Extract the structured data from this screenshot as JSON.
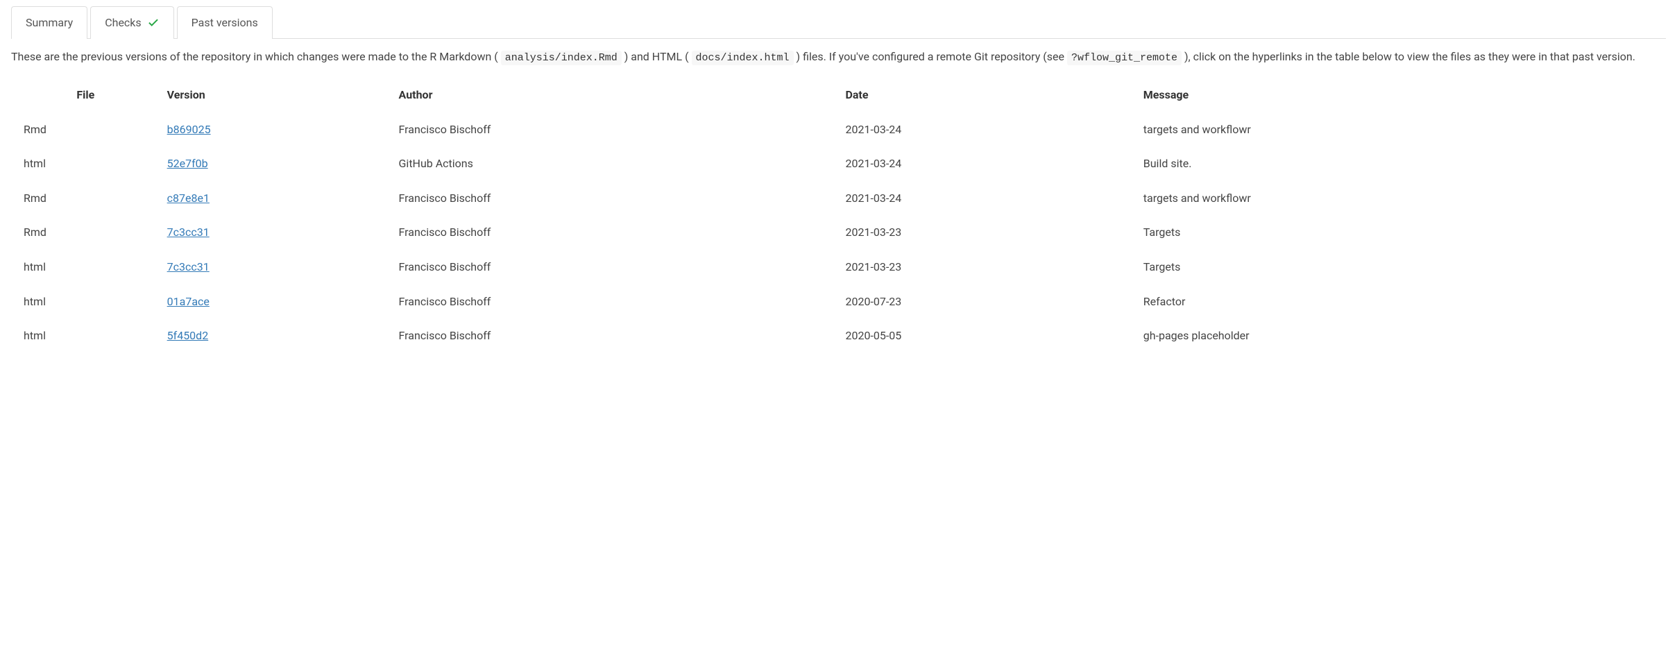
{
  "tabs": {
    "summary": "Summary",
    "checks": "Checks",
    "past_versions": "Past versions"
  },
  "intro": {
    "t1": "These are the previous versions of the repository in which changes were made to the R Markdown (",
    "code1": "analysis/index.Rmd",
    "t2": ") and HTML (",
    "code2": "docs/index.html",
    "t3": ") files. If you've configured a remote Git repository (see ",
    "code3": "?wflow_git_remote",
    "t4": "), click on the hyperlinks in the table below to view the files as they were in that past version."
  },
  "table": {
    "headers": {
      "file": "File",
      "version": "Version",
      "author": "Author",
      "date": "Date",
      "message": "Message"
    },
    "rows": [
      {
        "file": "Rmd",
        "version": "b869025",
        "author": "Francisco Bischoff",
        "date": "2021-03-24",
        "message": "targets and workflowr"
      },
      {
        "file": "html",
        "version": "52e7f0b",
        "author": "GitHub Actions",
        "date": "2021-03-24",
        "message": "Build site."
      },
      {
        "file": "Rmd",
        "version": "c87e8e1",
        "author": "Francisco Bischoff",
        "date": "2021-03-24",
        "message": "targets and workflowr"
      },
      {
        "file": "Rmd",
        "version": "7c3cc31",
        "author": "Francisco Bischoff",
        "date": "2021-03-23",
        "message": "Targets"
      },
      {
        "file": "html",
        "version": "7c3cc31",
        "author": "Francisco Bischoff",
        "date": "2021-03-23",
        "message": "Targets"
      },
      {
        "file": "html",
        "version": "01a7ace",
        "author": "Francisco Bischoff",
        "date": "2020-07-23",
        "message": "Refactor"
      },
      {
        "file": "html",
        "version": "5f450d2",
        "author": "Francisco Bischoff",
        "date": "2020-05-05",
        "message": "gh-pages placeholder"
      }
    ]
  }
}
